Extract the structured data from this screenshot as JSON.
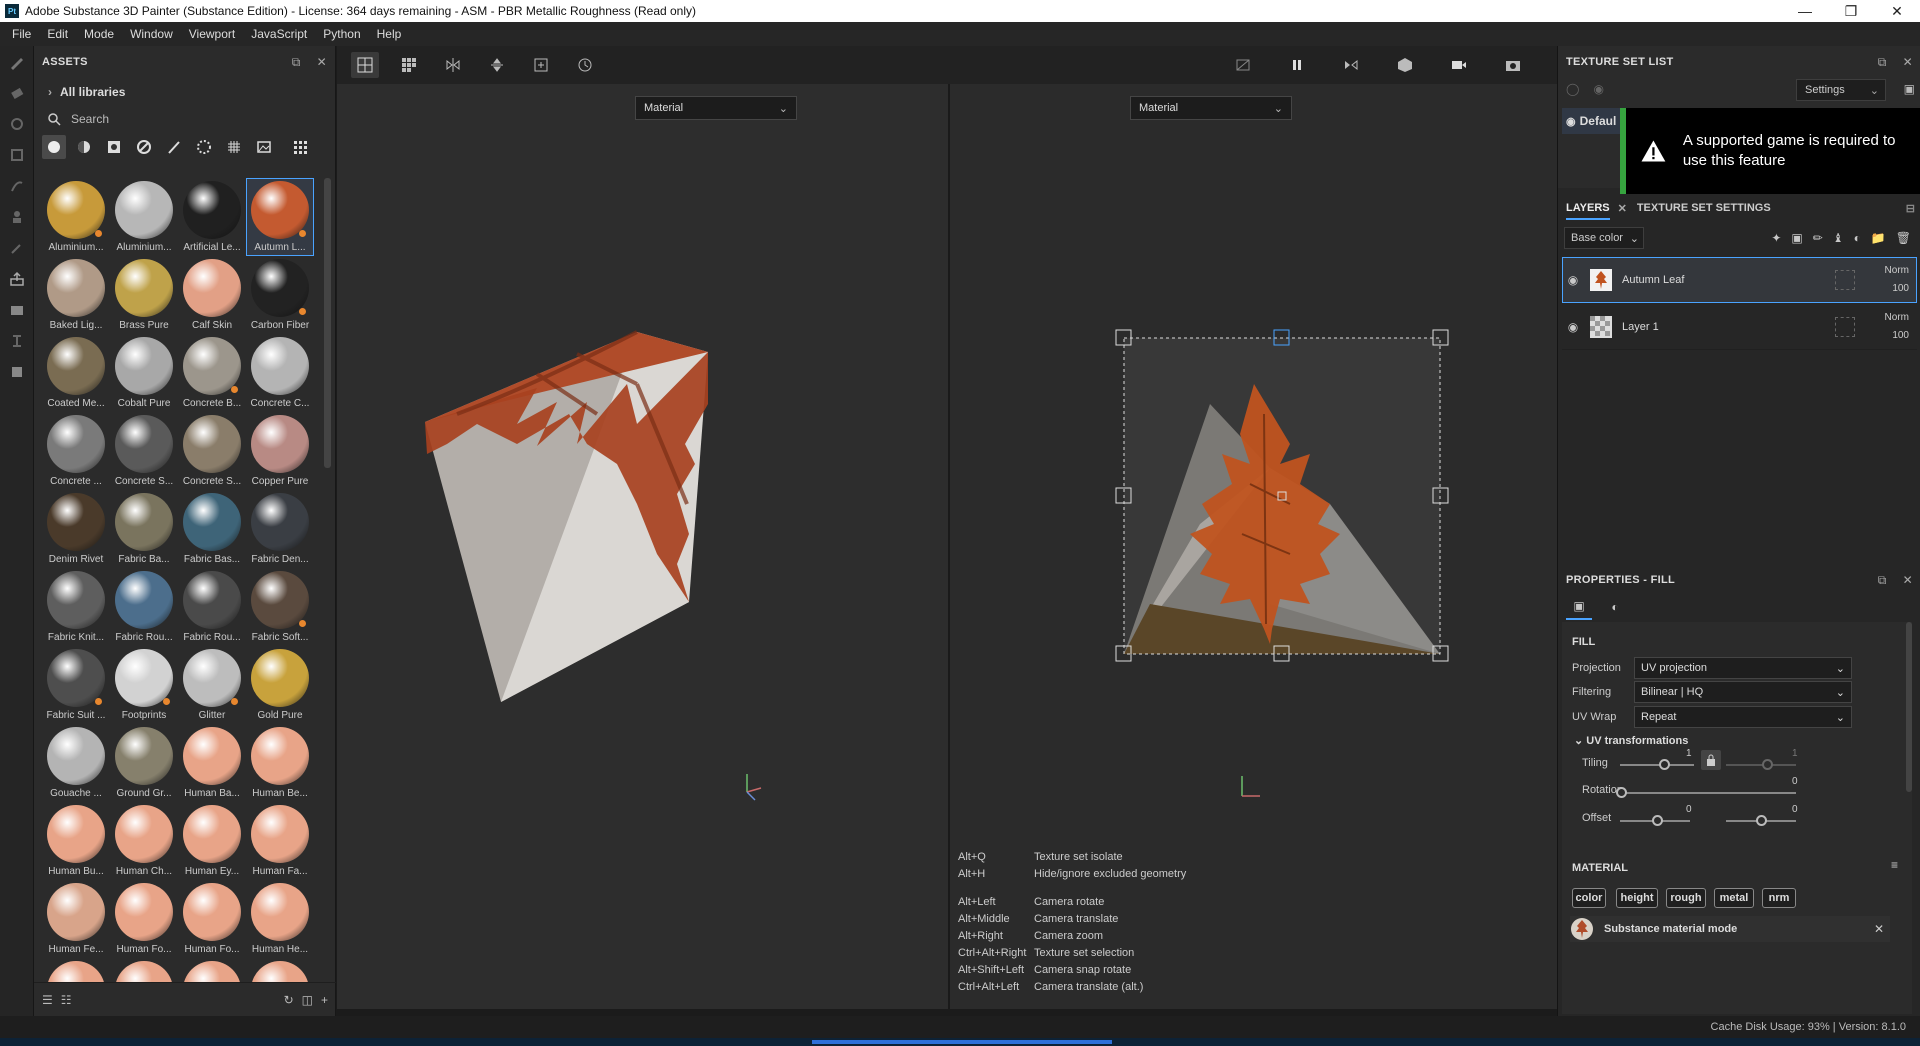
{
  "window": {
    "title": "Adobe Substance 3D Painter (Substance Edition) - License: 364 days remaining - ASM - PBR Metallic Roughness (Read only)",
    "logo_text": "Pt"
  },
  "menu": [
    "File",
    "Edit",
    "Mode",
    "Window",
    "Viewport",
    "JavaScript",
    "Python",
    "Help"
  ],
  "left_toolbar": [
    "paint-brush-icon",
    "eraser-icon",
    "projection-icon",
    "geometry-mask-icon",
    "smudge-icon",
    "clone-icon",
    "color-picker-icon",
    "export-icon",
    "bake-icon",
    "measure-icon",
    "viewer-settings-icon"
  ],
  "assets": {
    "title": "ASSETS",
    "library": "All libraries",
    "search_placeholder": "Search",
    "items": [
      {
        "label": "Aluminium...",
        "color": "#c79a3a",
        "dot": true
      },
      {
        "label": "Aluminium...",
        "color": "#b7b7b7",
        "dot": false
      },
      {
        "label": "Artificial Le...",
        "color": "#202020",
        "dot": false
      },
      {
        "label": "Autumn L...",
        "color": "#c45a30",
        "dot": true,
        "selected": true
      },
      {
        "label": "Baked Lig...",
        "color": "#b09a87",
        "dot": false
      },
      {
        "label": "Brass Pure",
        "color": "#bfa24a",
        "dot": false
      },
      {
        "label": "Calf Skin",
        "color": "#e2a086",
        "dot": false
      },
      {
        "label": "Carbon Fiber",
        "color": "#222222",
        "dot": true
      },
      {
        "label": "Coated Me...",
        "color": "#7a6c52",
        "dot": false
      },
      {
        "label": "Cobalt Pure",
        "color": "#a8a8a8",
        "dot": false
      },
      {
        "label": "Concrete B...",
        "color": "#9c968c",
        "dot": true
      },
      {
        "label": "Concrete C...",
        "color": "#b4b4b4",
        "dot": false
      },
      {
        "label": "Concrete ...",
        "color": "#7a7a7a",
        "dot": false
      },
      {
        "label": "Concrete S...",
        "color": "#5a5a5a",
        "dot": false
      },
      {
        "label": "Concrete S...",
        "color": "#8a7d6a",
        "dot": false
      },
      {
        "label": "Copper Pure",
        "color": "#b88a84",
        "dot": false
      },
      {
        "label": "Denim Rivet",
        "color": "#4a3a2a",
        "dot": false
      },
      {
        "label": "Fabric Ba...",
        "color": "#7a745e",
        "dot": false
      },
      {
        "label": "Fabric Bas...",
        "color": "#3e6478",
        "dot": false
      },
      {
        "label": "Fabric Den...",
        "color": "#3a3e44",
        "dot": false
      },
      {
        "label": "Fabric Knit...",
        "color": "#5e5e5e",
        "dot": false
      },
      {
        "label": "Fabric Rou...",
        "color": "#4c6e8c",
        "dot": false
      },
      {
        "label": "Fabric Rou...",
        "color": "#4a4a4a",
        "dot": false
      },
      {
        "label": "Fabric Soft...",
        "color": "#5a4a3e",
        "dot": true
      },
      {
        "label": "Fabric Suit ...",
        "color": "#4e4e4e",
        "dot": true
      },
      {
        "label": "Footprints",
        "color": "#d2d2d2",
        "dot": true
      },
      {
        "label": "Glitter",
        "color": "#bdbdbd",
        "dot": true
      },
      {
        "label": "Gold Pure",
        "color": "#c8a23c",
        "dot": false
      },
      {
        "label": "Gouache ...",
        "color": "#b4b4b4",
        "dot": false
      },
      {
        "label": "Ground Gr...",
        "color": "#86806c",
        "dot": false
      },
      {
        "label": "Human Ba...",
        "color": "#e8a488",
        "dot": false
      },
      {
        "label": "Human Be...",
        "color": "#e8a488",
        "dot": false
      },
      {
        "label": "Human Bu...",
        "color": "#e8a488",
        "dot": false
      },
      {
        "label": "Human Ch...",
        "color": "#e8a488",
        "dot": false
      },
      {
        "label": "Human Ey...",
        "color": "#e8a488",
        "dot": false
      },
      {
        "label": "Human Fa...",
        "color": "#e8a488",
        "dot": false
      },
      {
        "label": "Human Fe...",
        "color": "#d8a48a",
        "dot": false
      },
      {
        "label": "Human Fo...",
        "color": "#e8a488",
        "dot": false
      },
      {
        "label": "Human Fo...",
        "color": "#e8a488",
        "dot": false
      },
      {
        "label": "Human He...",
        "color": "#e8a488",
        "dot": false
      },
      {
        "label": "",
        "color": "#e8a488",
        "dot": false
      },
      {
        "label": "",
        "color": "#e8a488",
        "dot": false
      },
      {
        "label": "",
        "color": "#e8a488",
        "dot": false
      },
      {
        "label": "",
        "color": "#e8a488",
        "dot": false
      }
    ]
  },
  "viewports": {
    "left_mode": "Material",
    "right_mode": "Material"
  },
  "shortcuts": {
    "group1": [
      {
        "key": "Alt+Q",
        "action": "Texture set isolate"
      },
      {
        "key": "Alt+H",
        "action": "Hide/ignore excluded geometry"
      }
    ],
    "group2": [
      {
        "key": "Alt+Left",
        "action": "Camera rotate"
      },
      {
        "key": "Alt+Middle",
        "action": "Camera translate"
      },
      {
        "key": "Alt+Right",
        "action": "Camera zoom"
      },
      {
        "key": "Ctrl+Alt+Right",
        "action": "Texture set selection"
      },
      {
        "key": "Alt+Shift+Left",
        "action": "Camera snap rotate"
      },
      {
        "key": "Ctrl+Alt+Left",
        "action": "Camera translate (alt.)"
      }
    ]
  },
  "texture_set_list": {
    "title": "TEXTURE SET LIST",
    "settings": "Settings",
    "default_label": "Defaul",
    "warning": "A supported game is required to use this feature"
  },
  "layers": {
    "tab_layers": "LAYERS",
    "tab_texture_settings": "TEXTURE SET SETTINGS",
    "channel": "Base color",
    "rows": [
      {
        "name": "Autumn Leaf",
        "blend": "Norm",
        "opacity": "100"
      },
      {
        "name": "Layer 1",
        "blend": "Norm",
        "opacity": "100"
      }
    ]
  },
  "properties": {
    "title": "PROPERTIES - FILL",
    "fill_title": "FILL",
    "projection_label": "Projection",
    "projection_value": "UV projection",
    "filtering_label": "Filtering",
    "filtering_value": "Bilinear | HQ",
    "uvwrap_label": "UV Wrap",
    "uvwrap_value": "Repeat",
    "uvtrans_title": "UV transformations",
    "tiling_label": "Tiling",
    "tiling_value": "1",
    "tiling_value2": "1",
    "rotation_label": "Rotation",
    "rotation_value": "0",
    "offset_label": "Offset",
    "offset_value1": "0",
    "offset_value2": "0",
    "material_title": "MATERIAL",
    "chips": [
      "color",
      "height",
      "rough",
      "metal",
      "nrm"
    ],
    "substance_mode": "Substance material mode"
  },
  "status": {
    "text": "Cache Disk Usage:  93% | Version: 8.1.0"
  }
}
